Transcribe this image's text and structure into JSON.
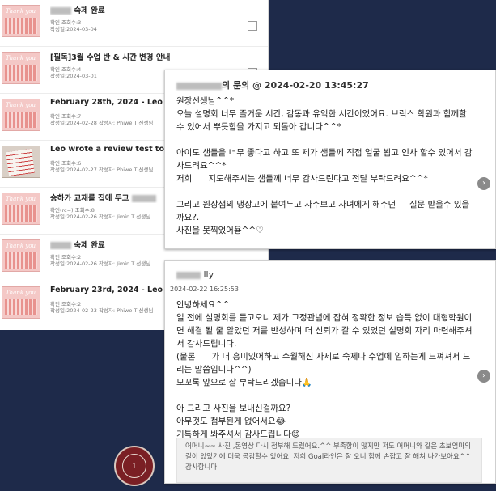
{
  "list": {
    "items": [
      {
        "thumb": "Thank you",
        "title": "숙제 완료",
        "meta": "확인    조회수:3",
        "meta2": "작성일:2024-03-04"
      },
      {
        "thumb": "Thank you",
        "title": "[필독]3월 수업 반 & 시간 변경 안내",
        "meta": "확인    조회수:4",
        "meta2": "작성일:2024-03-01"
      },
      {
        "thumb": "Thank you",
        "title": "February 28th, 2024 - Leo",
        "meta": "확인    조회수:7",
        "meta2": "작성일:2024-02-28    작성자: Phiwe T 선생님"
      },
      {
        "thumb": "",
        "title": "Leo wrote a review test today",
        "meta": "확인    조회수:6",
        "meta2": "작성일:2024-02-27    작성자: Phiwe T 선생님"
      },
      {
        "thumb": "Thank you",
        "title": "승하가 교재를 집에 두고",
        "meta": "확인(rc=)    조회수:8",
        "meta2": "작성일:2024-02-26    작성자: Jimin T 선생님"
      },
      {
        "thumb": "Thank you",
        "title": "숙제 완료",
        "meta": "확인    조회수:2",
        "meta2": "작성일:2024-02-26    작성자: Jimin T 선생님"
      },
      {
        "thumb": "Thank you",
        "title": "February 23rd, 2024 - Leo",
        "meta": "확인    조회수:2",
        "meta2": "작성일:2024-02-23    작성자: Phiwe T 선생님"
      }
    ]
  },
  "card1": {
    "header_suffix": "의 문의 @ 2024-02-20 13:45:27",
    "body": "원장선생님^^*\n오늘 설명회 너무 즐거운 시간, 감동과 유익한 시간이었어요. 브릭스 학원과 함께할 수 있어서 뿌듯함을 가지고 되돌아 갑니다^^*\n\n아이도 샘들을 너무 좋다고 하고 또 제가 샘들께 직접 얼굴 뵙고 인사 할수 있어서 감사드려요^^*\n저희      지도해주시는 샘들께 너무 감사드린다고 전달 부탁드려요^^*\n\n그리고 원장샘의 냉장고에 붙여두고 자주보고 자녀에게 해주던     질문 받을수 있을까요?.\n사진을 못찍었어용^^♡"
  },
  "card2": {
    "name_suffix": "lly",
    "date": "2024-02-22 16:25:53",
    "body": "안녕하세요^^\n일 전에 설명회를 듣고오니 제가 고정관념에 잡혀 정확한 정보 습득 없이 대형학원이면 해결 될 줄 알았던 저를 반성하며 더 신뢰가 갈 수 있었던 설명회 자리 마련해주셔서 감사드립니다.\n(물론      가 더 흥미있어하고 수월해진 자세로 숙제나 수업에 임하는게 느껴져서 드리는 말씀입니다^^)\n모꼬록 앞으로 잘 부탁드리겠습니다🙏\n\n아 그리고 사진을 보내신걸까요?\n아무것도 첨부된게 없어서요😂\n기특하게 봐주셔서 감사드립니다😊",
    "reply": "어머니~~ 사진 ,동영상 다시 첨부해 드렸어요.^^ 부족함이 많지만 저도 어머니와 같은 초보엄마의 길이 있었기에 더욱 공감할수 있어요. 저희 Goal라인은 잘 오니 함께 손잡고 잘 해쳐 나가보아요^^\n감사합니다."
  },
  "logo": {
    "text": "1"
  },
  "colors": {
    "background": "#1e2a4a",
    "thumb_pink": "#f4c8c6",
    "logo_red": "#7a1f24"
  }
}
